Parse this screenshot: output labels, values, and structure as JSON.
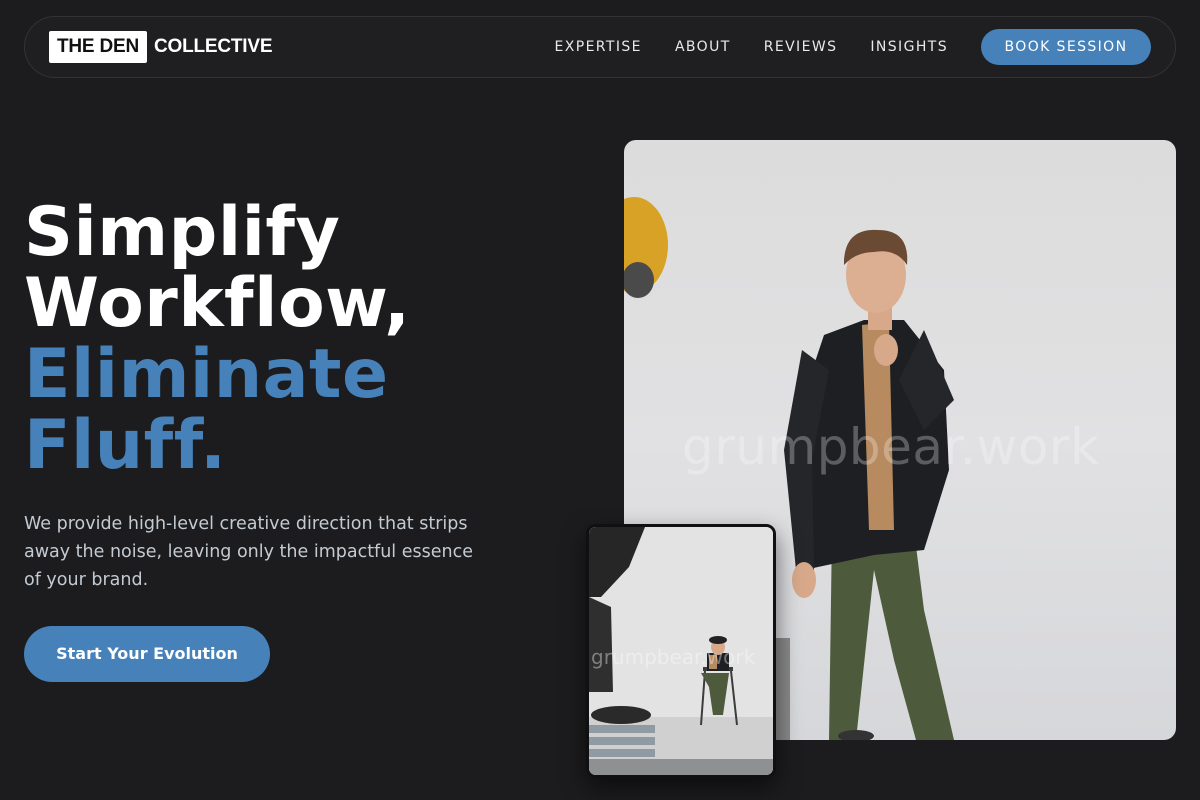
{
  "brand": {
    "logo_box": "THE DEN",
    "logo_text": "COLLECTIVE"
  },
  "nav": {
    "links": [
      "EXPERTISE",
      "ABOUT",
      "REVIEWS",
      "INSIGHTS"
    ],
    "cta": "BOOK SESSION"
  },
  "hero": {
    "title_lines": [
      "Simplify",
      "Workflow,"
    ],
    "title_accent_lines": [
      "Eliminate",
      "Fluff."
    ],
    "subtitle": "We provide high-level creative direction that strips away the noise, leaving only the impactful essence of your brand.",
    "cta": "Start Your Evolution"
  },
  "images": {
    "main_watermark": "grumpbear.work",
    "small_watermark": "grumpbear.work"
  },
  "colors": {
    "background": "#1c1c1e",
    "accent": "#4682b9",
    "text": "#ffffff",
    "muted_text": "#c4cad2"
  }
}
